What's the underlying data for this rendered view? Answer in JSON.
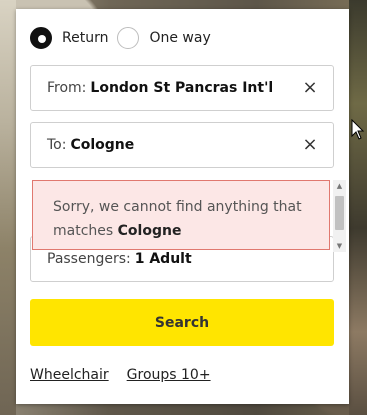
{
  "trip_type": {
    "options": [
      {
        "label": "Return",
        "selected": true
      },
      {
        "label": "One way",
        "selected": false
      }
    ]
  },
  "from": {
    "label": "From:",
    "value": "London St Pancras Int'l",
    "clear_icon": "×"
  },
  "to": {
    "label": "To:",
    "value": "Cologne",
    "clear_icon": "×"
  },
  "error": {
    "text_line1": "Sorry, we cannot find anything that",
    "text_prefix": "matches",
    "term": "Cologne"
  },
  "passengers": {
    "label": "Passengers:",
    "value": "1 Adult"
  },
  "search": {
    "label": "Search"
  },
  "links": {
    "wheelchair": "Wheelchair",
    "groups": "Groups 10+"
  },
  "colors": {
    "accent": "#ffe500",
    "error_bg": "#fce7e6",
    "error_border": "#e0786f"
  },
  "icons": {
    "clear": "close-icon",
    "scroll_up": "triangle-up-icon",
    "scroll_down": "triangle-down-icon",
    "cursor": "mouse-pointer-icon"
  }
}
